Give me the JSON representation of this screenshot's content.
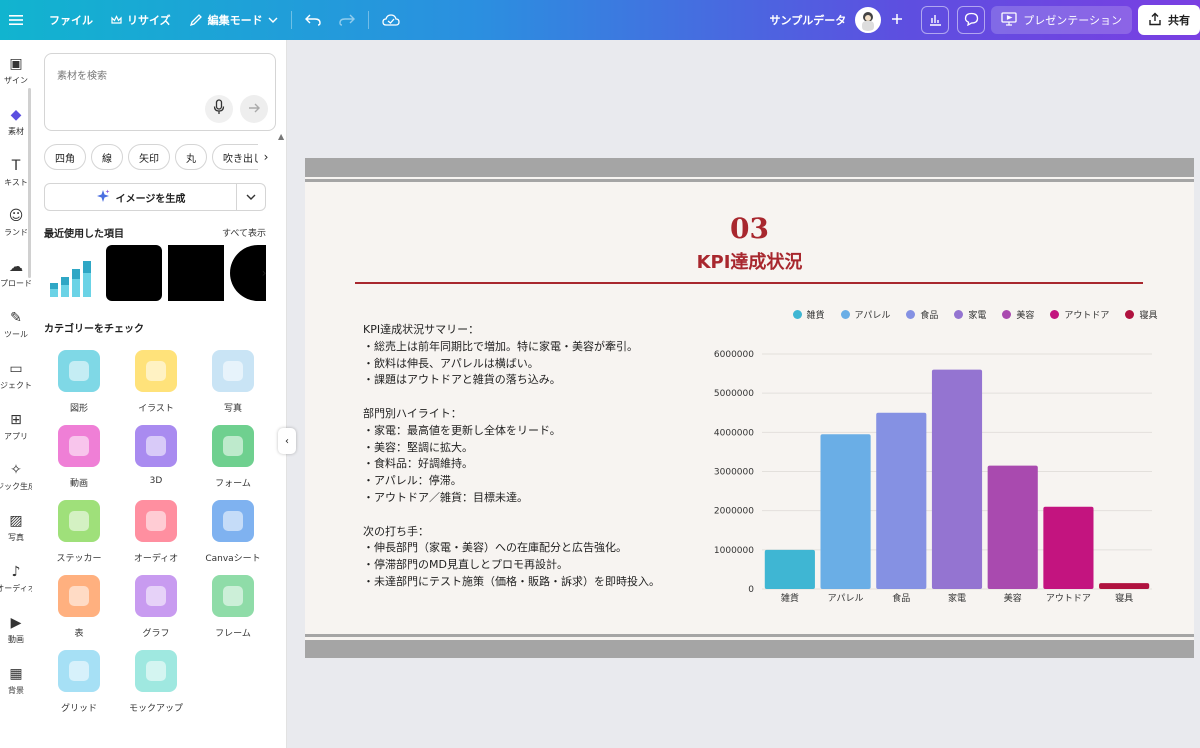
{
  "topbar": {
    "menu_icon": "hamburger-icon",
    "file": "ファイル",
    "resize": "リサイズ",
    "edit_mode": "編集モード",
    "sample_data": "サンプルデータ",
    "present": "プレゼンテーション",
    "share": "共有"
  },
  "rail": {
    "items": [
      {
        "label": "ザイン",
        "icon": "design-icon"
      },
      {
        "label": "素材",
        "icon": "elements-icon"
      },
      {
        "label": "キスト",
        "icon": "text-icon"
      },
      {
        "label": "ランド",
        "icon": "brand-icon"
      },
      {
        "label": "プロード",
        "icon": "upload-icon"
      },
      {
        "label": "ツール",
        "icon": "draw-icon"
      },
      {
        "label": "ジェクト",
        "icon": "projects-icon"
      },
      {
        "label": "アプリ",
        "icon": "apps-icon"
      },
      {
        "label": "ジック生成",
        "icon": "magic-icon"
      },
      {
        "label": "写真",
        "icon": "photos-icon"
      },
      {
        "label": "オーディオ",
        "icon": "audio-icon"
      },
      {
        "label": "動画",
        "icon": "video-icon"
      },
      {
        "label": "背景",
        "icon": "background-icon"
      }
    ]
  },
  "panel": {
    "search_placeholder": "素材を検索",
    "chips": [
      "四角",
      "線",
      "矢印",
      "丸",
      "吹き出し"
    ],
    "generate_label": "イメージを生成",
    "recent_title": "最近使用した項目",
    "see_all": "すべて表示",
    "categories_title": "カテゴリーをチェック",
    "categories": [
      {
        "label": "図形",
        "icon": "shapes-icon"
      },
      {
        "label": "イラスト",
        "icon": "illustration-icon"
      },
      {
        "label": "写真",
        "icon": "photo-icon"
      },
      {
        "label": "動画",
        "icon": "video-icon"
      },
      {
        "label": "3D",
        "icon": "cube-icon"
      },
      {
        "label": "フォーム",
        "icon": "form-icon"
      },
      {
        "label": "ステッカー",
        "icon": "sticker-icon"
      },
      {
        "label": "オーディオ",
        "icon": "music-icon"
      },
      {
        "label": "Canvaシート",
        "icon": "sheet-icon"
      },
      {
        "label": "表",
        "icon": "table-icon"
      },
      {
        "label": "グラフ",
        "icon": "graph-icon"
      },
      {
        "label": "フレーム",
        "icon": "frame-icon"
      },
      {
        "label": "グリッド",
        "icon": "grid-icon"
      },
      {
        "label": "モックアップ",
        "icon": "mockup-icon"
      }
    ]
  },
  "slide": {
    "number": "03",
    "title": "KPI達成状況",
    "paragraphs": [
      [
        "KPI達成状況サマリー：",
        "・総売上は前年同期比で増加。特に家電・美容が牽引。",
        "・飲料は伸長、アパレルは横ばい。",
        "・課題はアウトドアと雑貨の落ち込み。"
      ],
      [
        "部門別ハイライト：",
        "・家電：最高値を更新し全体をリード。",
        "・美容：堅調に拡大。",
        "・食料品：好調維持。",
        "・アパレル：停滞。",
        "・アウトドア／雑貨：目標未達。"
      ],
      [
        "次の打ち手：",
        "・伸長部門（家電・美容）への在庫配分と広告強化。",
        "・停滞部門のMD見直しとプロモ再設計。",
        "・未達部門にテスト施策（価格・販路・訴求）を即時投入。"
      ]
    ]
  },
  "chart_data": {
    "type": "bar",
    "categories": [
      "雑貨",
      "アパレル",
      "食品",
      "家電",
      "美容",
      "アウトドア",
      "寝具"
    ],
    "values": [
      1000000,
      3950000,
      4500000,
      5600000,
      3150000,
      2100000,
      150000
    ],
    "colors": [
      "#3fb6d3",
      "#6aaee6",
      "#8591e3",
      "#9474d1",
      "#a94aaf",
      "#c3147f",
      "#b0123f"
    ],
    "legend": [
      "雑貨",
      "アパレル",
      "食品",
      "家電",
      "美容",
      "アウトドア",
      "寝具"
    ],
    "ylim": [
      0,
      6000000
    ],
    "yticks": [
      "0",
      "1000000",
      "2000000",
      "3000000",
      "4000000",
      "5000000",
      "6000000"
    ],
    "legend_position": "top",
    "grid": true
  }
}
